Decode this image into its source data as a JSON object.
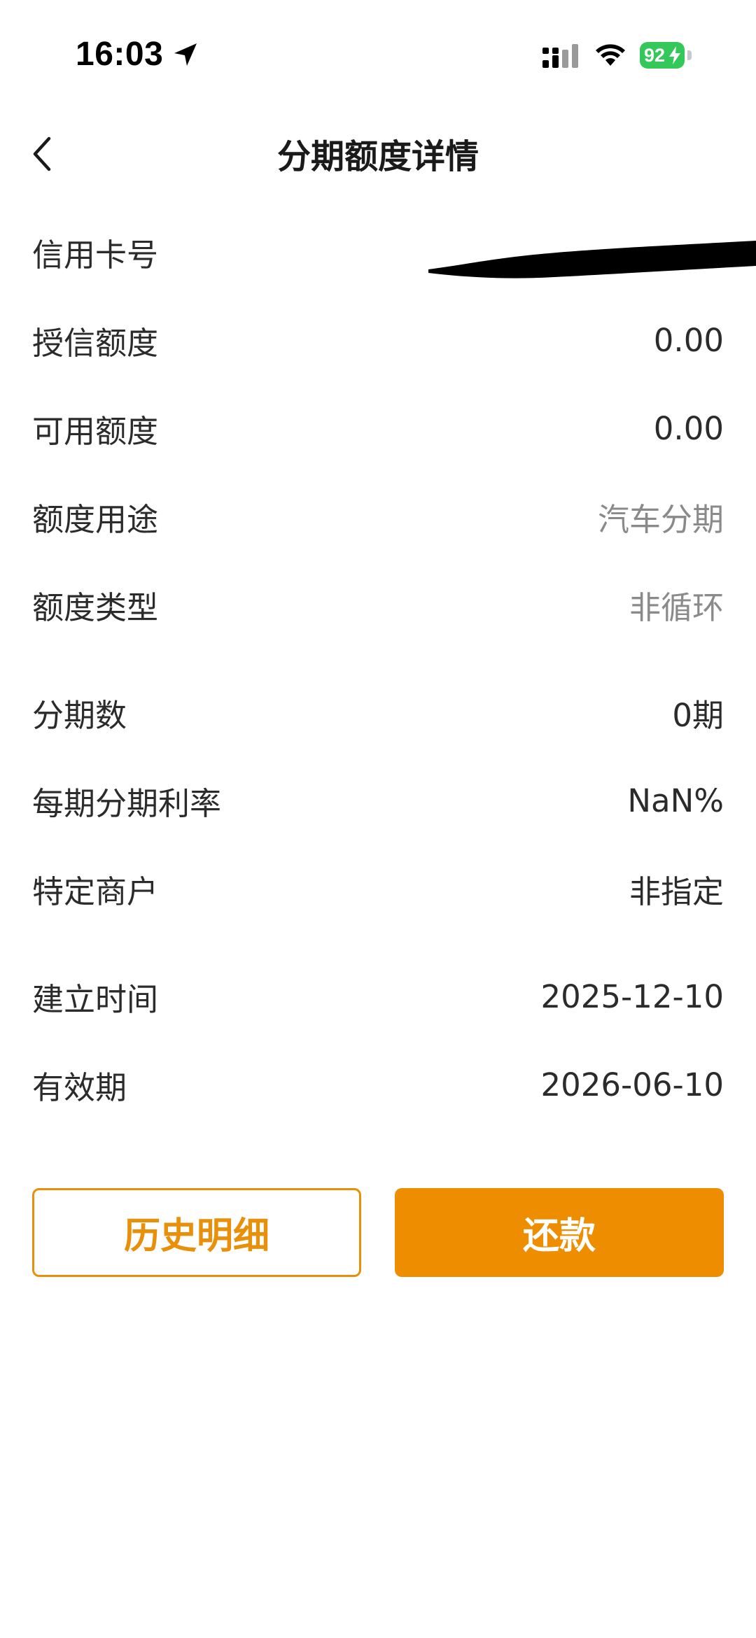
{
  "status_bar": {
    "time": "16:03",
    "battery": "92",
    "icons": [
      "location-arrow-icon",
      "cellular-signal-icon",
      "wifi-icon",
      "battery-icon"
    ]
  },
  "nav": {
    "title": "分期额度详情",
    "back_icon": "chevron-left-icon"
  },
  "rows": [
    {
      "label": "信用卡号",
      "value": "",
      "redacted": true
    },
    {
      "label": "授信额度",
      "value": "0.00"
    },
    {
      "label": "可用额度",
      "value": "0.00"
    },
    {
      "label": "额度用途",
      "value": "汽车分期"
    },
    {
      "label": "额度类型",
      "value": "非循环"
    },
    {
      "label": "分期数",
      "value": "0期"
    },
    {
      "label": "每期分期利率",
      "value": "NaN%"
    },
    {
      "label": "特定商户",
      "value": "非指定"
    },
    {
      "label": "建立时间",
      "value": "2025-12-10"
    },
    {
      "label": "有效期",
      "value": "2026-06-10"
    }
  ],
  "buttons": {
    "history": "历史明细",
    "repay": "还款"
  },
  "colors": {
    "accent": "#ef8d00",
    "battery_green": "#34c759",
    "muted_text": "#8a8a8a",
    "text": "#2b2b2b"
  }
}
